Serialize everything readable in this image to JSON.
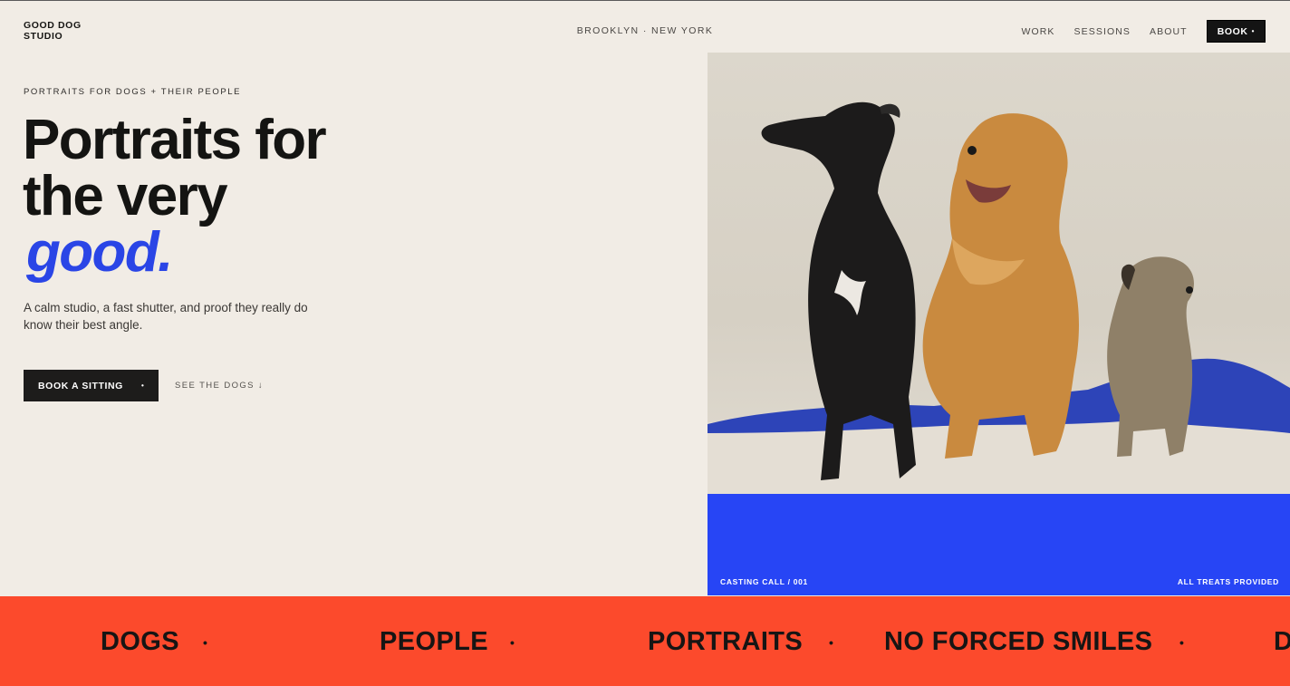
{
  "brand": {
    "name": "GOOD DOG\nSTUDIO"
  },
  "header": {
    "location": "BROOKLYN · NEW YORK",
    "nav": [
      "WORK",
      "SESSIONS",
      "ABOUT"
    ],
    "book_label": "BOOK",
    "book_dot": "•"
  },
  "hero": {
    "eyebrow": "PORTRAITS FOR DOGS + THEIR PEOPLE",
    "headline_line1": "Portraits for",
    "headline_line2": "the very",
    "headline_accent": "good.",
    "subtitle": "A calm studio, a fast shutter, and proof they really do know their best angle.",
    "cta_label": "BOOK A SITTING",
    "cta_dot": "•",
    "secondary_link": "SEE THE DOGS ↓"
  },
  "panel": {
    "left_caption": "CASTING CALL / 001",
    "right_caption": "ALL TREATS PROVIDED"
  },
  "ticker": {
    "items": [
      "DOGS",
      "PEOPLE",
      "PORTRAITS",
      "NO FORCED SMILES",
      "D"
    ],
    "separator": "•"
  },
  "colors": {
    "background": "#f1ece5",
    "accent_blue": "#2a45e6",
    "panel_blue": "#2745f5",
    "ticker_orange": "#fc4a2c",
    "ink": "#141412"
  }
}
